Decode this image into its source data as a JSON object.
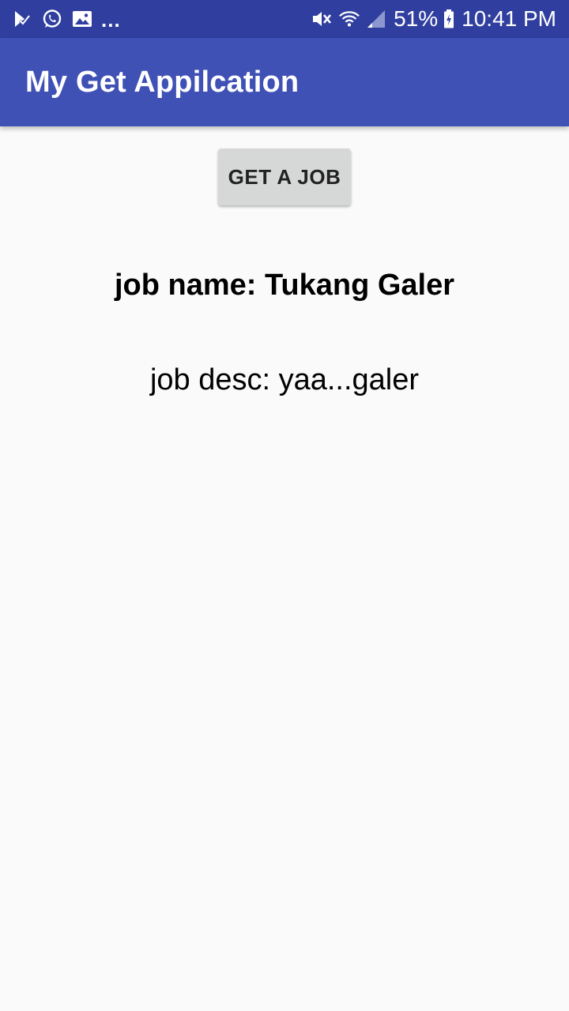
{
  "status_bar": {
    "left_icons": [
      "play-store-download-icon",
      "whatsapp-icon",
      "image-icon"
    ],
    "more_indicator": "...",
    "right_icons": [
      "mute-vibrate-icon",
      "wifi-icon",
      "cell-signal-icon",
      "battery-icon"
    ],
    "battery_percent": "51%",
    "time": "10:41 PM"
  },
  "app_bar": {
    "title": "My Get Appilcation"
  },
  "main": {
    "get_job_button_label": "GET A JOB",
    "job_name_text": "job name: Tukang Galer",
    "job_desc_text": "job desc: yaa...galer"
  },
  "colors": {
    "status_bar": "#303f9f",
    "app_bar": "#3f51b5",
    "background": "#fafafa",
    "button": "#d6d7d7"
  }
}
